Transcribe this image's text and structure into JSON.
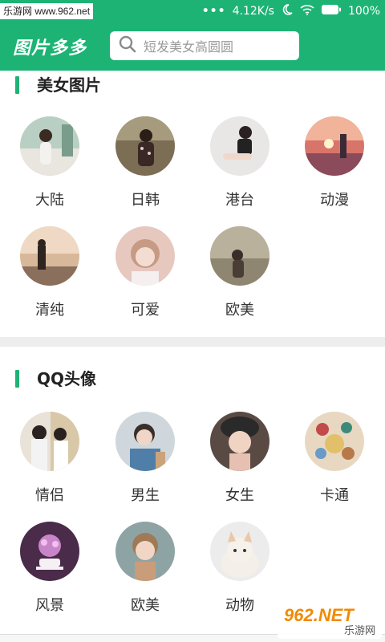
{
  "status_bar": {
    "watermark": "乐游网 www.962.net",
    "dots": "•••",
    "speed": "4.12K/s",
    "battery": "100%"
  },
  "header": {
    "app_title": "图片多多",
    "search_placeholder": "短发美女高圆圆"
  },
  "sections": [
    {
      "title": "美女图片",
      "items": [
        {
          "label": "大陆"
        },
        {
          "label": "日韩"
        },
        {
          "label": "港台"
        },
        {
          "label": "动漫"
        },
        {
          "label": "清纯"
        },
        {
          "label": "可爱"
        },
        {
          "label": "欧美"
        }
      ]
    },
    {
      "title": "QQ头像",
      "items": [
        {
          "label": "情侣"
        },
        {
          "label": "男生"
        },
        {
          "label": "女生"
        },
        {
          "label": "卡通"
        },
        {
          "label": "风景"
        },
        {
          "label": "欧美"
        },
        {
          "label": "动物"
        }
      ]
    }
  ],
  "watermark_bottom": {
    "main": "962.NET",
    "sub": "乐游网"
  },
  "colors": {
    "accent": "#1db374"
  },
  "icons": [
    "search-icon",
    "wifi-icon",
    "moon-icon",
    "battery-icon"
  ]
}
